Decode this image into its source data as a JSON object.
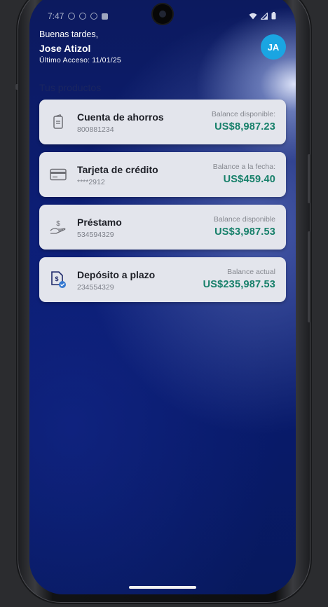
{
  "status_bar": {
    "time": "7:47"
  },
  "header": {
    "greeting": "Buenas tardes,",
    "user_name": "Jose Atizol",
    "last_access_label": "Último Acceso:",
    "last_access_date": "11/01/25",
    "avatar_initials": "JA"
  },
  "products": {
    "section_title": "Tus productos",
    "items": [
      {
        "name": "Cuenta de ahorros",
        "number": "800881234",
        "balance_label": "Balance disponible:",
        "balance_value": "US$8,987.23",
        "icon": "savings-account-icon"
      },
      {
        "name": "Tarjeta de crédito",
        "number": "****2912",
        "balance_label": "Balance a la fecha:",
        "balance_value": "US$459.40",
        "icon": "credit-card-icon"
      },
      {
        "name": "Préstamo",
        "number": "534594329",
        "balance_label": "Balance disponible",
        "balance_value": "US$3,987.53",
        "icon": "loan-hand-dollar-icon"
      },
      {
        "name": "Depósito a plazo",
        "number": "234554329",
        "balance_label": "Balance actual",
        "balance_value": "US$235,987.53",
        "icon": "term-deposit-document-icon"
      }
    ]
  },
  "colors": {
    "avatar": "#1aa5e2",
    "balance_value": "#17806a",
    "card_background": "#e3e5ec",
    "screen_background": "#0b1d74"
  }
}
